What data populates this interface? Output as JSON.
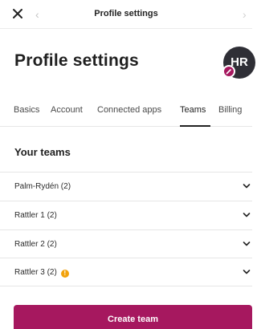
{
  "topbar": {
    "title": "Profile settings",
    "close_icon": "close-icon",
    "back_icon": "chevron-left-icon",
    "forward_icon": "chevron-right-icon"
  },
  "header": {
    "title": "Profile settings",
    "avatar_initials": "HR",
    "avatar_badge_icon": "pencil-icon"
  },
  "tabs": [
    {
      "label": "Basics",
      "active": false
    },
    {
      "label": "Account",
      "active": false
    },
    {
      "label": "Connected apps",
      "active": false
    },
    {
      "label": "Teams",
      "active": true
    },
    {
      "label": "Billing",
      "active": false
    }
  ],
  "teams": {
    "title": "Your teams",
    "items": [
      {
        "label": "Palm-Rydén (2)",
        "warning": false
      },
      {
        "label": "Rattler 1 (2)",
        "warning": false
      },
      {
        "label": "Rattler 2 (2)",
        "warning": false
      },
      {
        "label": "Rattler 3 (2)",
        "warning": true,
        "warning_glyph": "!"
      }
    ]
  },
  "actions": {
    "create_team_label": "Create team"
  },
  "colors": {
    "brand": "#a6185f",
    "warning": "#f2a20c",
    "avatar_bg": "#2f2f36"
  }
}
